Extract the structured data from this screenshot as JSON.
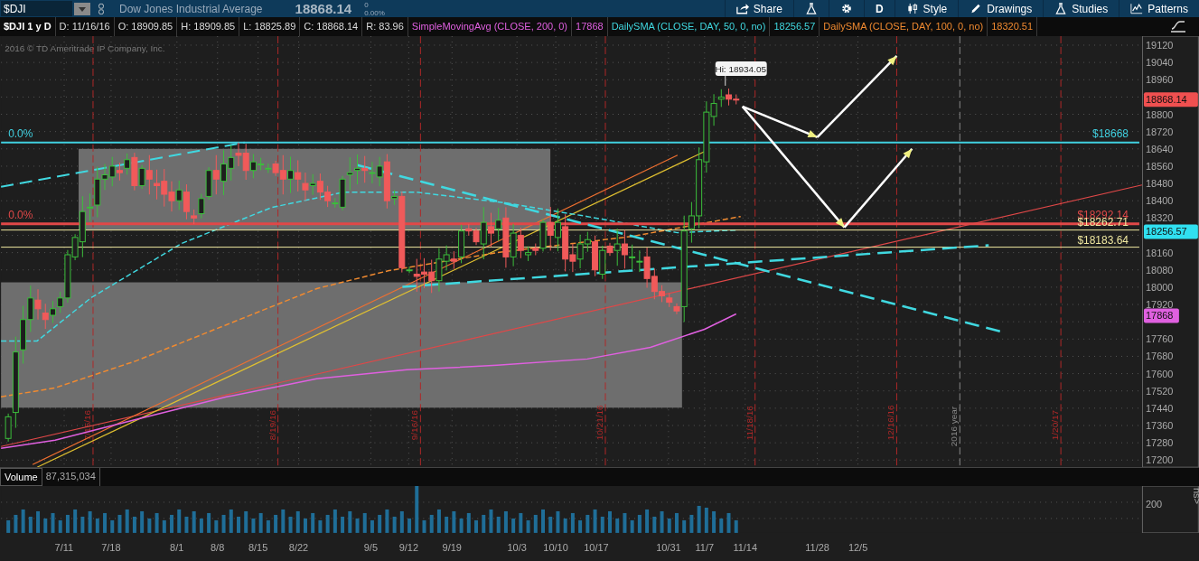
{
  "toolbar": {
    "symbol": "$DJI",
    "name": "Dow Jones Industrial Average",
    "last": "18868.14",
    "change": "0",
    "change_pct": "0.00%",
    "buttons": [
      {
        "kind": "share",
        "label": "Share"
      },
      {
        "kind": "flask"
      },
      {
        "kind": "gear"
      },
      {
        "kind": "text",
        "label": "D"
      },
      {
        "kind": "style",
        "label": "Style"
      },
      {
        "kind": "pencil",
        "label": "Drawings"
      },
      {
        "kind": "flask",
        "label": "Studies"
      },
      {
        "kind": "patterns",
        "label": "Patterns"
      }
    ]
  },
  "legend": {
    "title": "$DJI 1 y D",
    "fields": [
      "D: 11/16/16",
      "O: 18909.85",
      "H: 18909.85",
      "L: 18825.89",
      "C: 18868.14",
      "R: 83.96"
    ],
    "studies": [
      {
        "name": "SimpleMovingAvg (CLOSE, 200, 0)",
        "value": "17868",
        "color": "#e060e0"
      },
      {
        "name": "DailySMA (CLOSE, DAY, 50, 0, no)",
        "value": "18256.57",
        "color": "#40d8e0"
      },
      {
        "name": "DailySMA (CLOSE, DAY, 100, 0, no)",
        "value": "18320.51",
        "color": "#f08a30"
      }
    ]
  },
  "chart": {
    "copyright": "2016 © TD Ameritrade IP Company, Inc.",
    "high_bubble": "Hi: 18934.05",
    "y_ticks": [
      "19120",
      "19040",
      "18960",
      "18800",
      "18720",
      "18640",
      "18560",
      "18480",
      "18400",
      "18320",
      "18160",
      "18080",
      "18000",
      "17920",
      "17760",
      "17680",
      "17600",
      "17520",
      "17440",
      "17360",
      "17280",
      "17200"
    ],
    "price_tags": [
      {
        "text": "18868.14",
        "color": "#f05050"
      },
      {
        "text": "18256.57",
        "color": "#30e0f0"
      },
      {
        "text": "17868",
        "color": "#e060e0"
      }
    ],
    "line_labels": [
      {
        "text": "0.0%",
        "color": "#40d0e0"
      },
      {
        "text": "$18668",
        "color": "#40d0e0"
      },
      {
        "text": "0.0%",
        "color": "#e04848"
      },
      {
        "text": "$18292.14",
        "color": "#e04848"
      },
      {
        "text": "$18262.71",
        "color": "#f0e8a0"
      },
      {
        "text": "$18183.64",
        "color": "#f0e8a0"
      }
    ],
    "date_markers": [
      {
        "text": "7/15/16",
        "kind": "expiry"
      },
      {
        "text": "8/19/16",
        "kind": "expiry"
      },
      {
        "text": "9/16/16",
        "kind": "expiry"
      },
      {
        "text": "10/21/16",
        "kind": "expiry"
      },
      {
        "text": "11/18/16",
        "kind": "expiry"
      },
      {
        "text": "12/16/16",
        "kind": "expiry"
      },
      {
        "text": "2016 year",
        "kind": "year"
      },
      {
        "text": "1/20/17",
        "kind": "expiry"
      }
    ]
  },
  "volume": {
    "label": "Volume",
    "value": "87,315,034",
    "y_tick": "200",
    "side_tab": "ns>"
  },
  "x_labels": [
    "7/11",
    "7/18",
    "8/1",
    "8/8",
    "8/15",
    "8/22",
    "9/5",
    "9/12",
    "9/19",
    "10/3",
    "10/10",
    "10/17",
    "10/31",
    "11/7",
    "11/14",
    "11/28",
    "12/5"
  ]
}
